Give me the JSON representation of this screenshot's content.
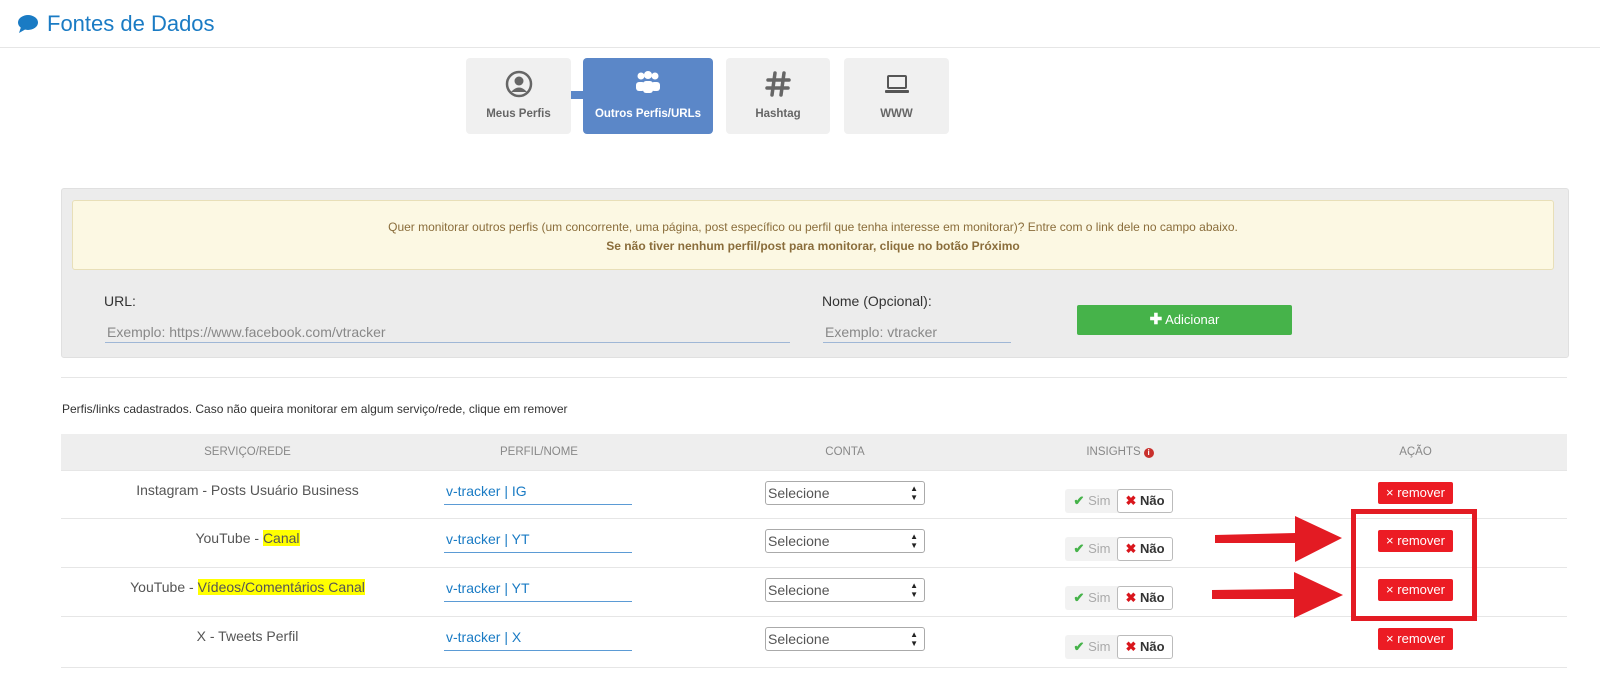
{
  "header": {
    "title": "Fontes de Dados",
    "icon": "chat-bubble-icon",
    "color": "#1a7bc4"
  },
  "tabs": [
    {
      "label": "Meus Perfis",
      "icon": "user-circle-icon",
      "active": false
    },
    {
      "label": "Outros Perfis/URLs",
      "icon": "users-group-icon",
      "active": true
    },
    {
      "label": "Hashtag",
      "icon": "hashtag-icon",
      "active": false
    },
    {
      "label": "WWW",
      "icon": "laptop-icon",
      "active": false
    }
  ],
  "notice": {
    "line1": "Quer monitorar outros perfis (um concorrente, uma página, post específico ou perfil que tenha interesse em monitorar)? Entre com o link dele no campo abaixo.",
    "line2": "Se não tiver nenhum perfil/post para monitorar, clique no botão Próximo"
  },
  "form": {
    "url_label": "URL:",
    "url_placeholder": "Exemplo: https://www.facebook.com/vtracker",
    "name_label": "Nome (Opcional):",
    "name_placeholder": "Exemplo: vtracker",
    "add_button_label": "Adicionar"
  },
  "table": {
    "info_text": "Perfis/links cadastrados. Caso não queira monitorar em algum serviço/rede, clique em remover",
    "headers": [
      "SERVIÇO/REDE",
      "PERFIL/NOME",
      "CONTA",
      "INSIGHTS",
      "AÇÃO"
    ],
    "rows": [
      {
        "service_prefix": "Instagram - Posts Usuário Business",
        "service_highlight": "",
        "perfil": "v-tracker | IG",
        "conta": "Selecione",
        "sim": "Sim",
        "nao": "Não",
        "action": "remover"
      },
      {
        "service_prefix": "YouTube - ",
        "service_highlight": "Canal",
        "perfil": "v-tracker | YT",
        "conta": "Selecione",
        "sim": "Sim",
        "nao": "Não",
        "action": "remover"
      },
      {
        "service_prefix": "YouTube - ",
        "service_highlight": "Vídeos/Comentários Canal",
        "perfil": "v-tracker | YT",
        "conta": "Selecione",
        "sim": "Sim",
        "nao": "Não",
        "action": "remover"
      },
      {
        "service_prefix": "X - Tweets Perfil",
        "service_highlight": "",
        "perfil": "v-tracker | X",
        "conta": "Selecione",
        "sim": "Sim",
        "nao": "Não",
        "action": "remover"
      }
    ]
  },
  "colors": {
    "accent": "#5b87c8",
    "add": "#46b34a",
    "remove": "#ec1c24",
    "annotation": "#e31b23",
    "highlight": "#ffff00"
  }
}
